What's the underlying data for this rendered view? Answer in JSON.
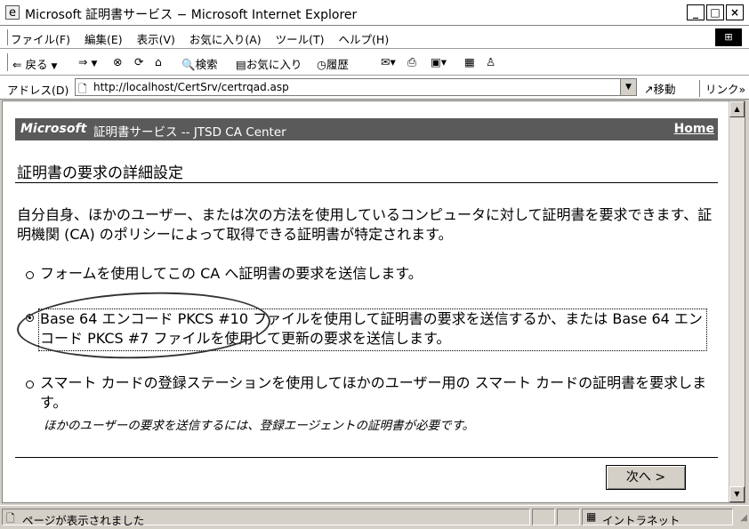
{
  "window": {
    "title": "Microsoft 証明書サービス − Microsoft Internet Explorer",
    "minimize": "_",
    "maximize": "□",
    "close": "×"
  },
  "menu": [
    "ファイル(F)",
    "編集(E)",
    "表示(V)",
    "お気に入り(A)",
    "ツール(T)",
    "ヘルプ(H)"
  ],
  "toolbar": {
    "back": "戻る",
    "search": "検索",
    "favorites": "お気に入り",
    "history": "履歴"
  },
  "address": {
    "label": "アドレス(D)",
    "url": "http://localhost/CertSrv/certrqad.asp",
    "go": "移動",
    "links": "リンク"
  },
  "page": {
    "banner_brand": "Microsoft",
    "banner_service": "証明書サービス  --  JTSD CA Center",
    "home": "Home",
    "title": "証明書の要求の詳細設定",
    "intro": "自分自身、ほかのユーザー、または次の方法を使用しているコンピュータに対して証明書を要求できます、証明機関 (CA) のポリシーによって取得できる証明書が特定されます。",
    "options": [
      {
        "label": "フォームを使用してこの CA へ証明書の要求を送信します。",
        "checked": false
      },
      {
        "label": "Base 64 エンコード PKCS #10 ファイルを使用して証明書の要求を送信するか、または Base 64 エンコード PKCS #7 ファイルを使用して更新の要求を送信します。",
        "checked": true
      },
      {
        "label": "スマート カードの登録ステーションを使用してほかのユーザー用の スマート カードの証明書を要求します。",
        "checked": false
      }
    ],
    "note": "ほかのユーザーの要求を送信するには、登録エージェントの証明書が必要です。",
    "next": "次へ >"
  },
  "status": {
    "text": "ページが表示されました",
    "zone": "イントラネット"
  }
}
